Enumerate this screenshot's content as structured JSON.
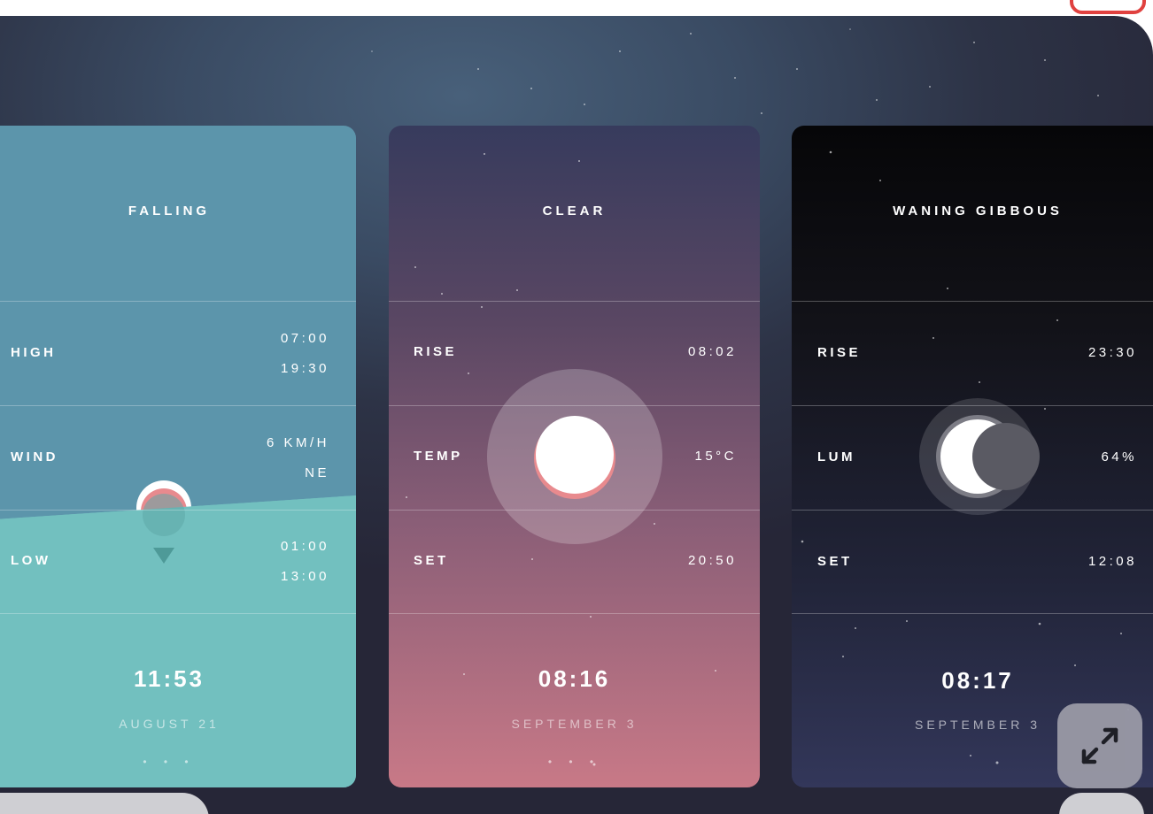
{
  "cards": {
    "tide": {
      "title": "FALLING",
      "high_label": "HIGH",
      "high_time_1": "07:00",
      "high_time_2": "19:30",
      "wind_label": "WIND",
      "wind_speed": "6 KM/H",
      "wind_dir": "NE",
      "low_label": "LOW",
      "low_time_1": "01:00",
      "low_time_2": "13:00",
      "time": "11:53",
      "date": "AUGUST 21",
      "dots": "• • •"
    },
    "sun": {
      "title": "CLEAR",
      "rise_label": "RISE",
      "rise_time": "08:02",
      "temp_label": "TEMP",
      "temp_value": "15°C",
      "set_label": "SET",
      "set_time": "20:50",
      "time": "08:16",
      "date": "SEPTEMBER 3",
      "dots": "• • •"
    },
    "moon": {
      "title": "WANING GIBBOUS",
      "rise_label": "RISE",
      "rise_time": "23:30",
      "lum_label": "LUM",
      "lum_value": "64%",
      "set_label": "SET",
      "set_time": "12:08",
      "time": "08:17",
      "date": "SEPTEMBER 3",
      "dots": "• • •"
    }
  },
  "controls": {
    "expand_icon": "expand-arrows-icon"
  },
  "colors": {
    "tide": "#5c95ab",
    "sea": "#72c0bf",
    "sun_accent": "#e88a8e",
    "accent_badge": "#e0413f"
  }
}
